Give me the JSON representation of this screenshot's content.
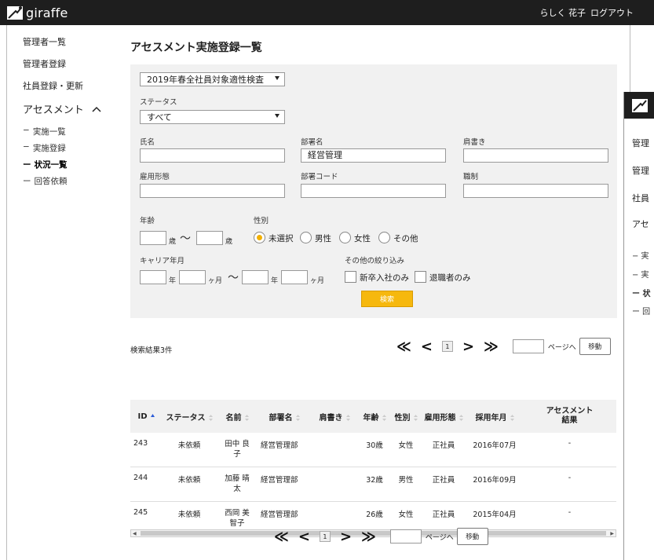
{
  "app": {
    "name": "giraffe",
    "user_name": "らしく 花子",
    "logout_label": "ログアウト"
  },
  "sidebar": {
    "items": [
      "管理者一覧",
      "管理者登録",
      "社員登録・更新"
    ],
    "accordion_label": "アセスメント",
    "sub_items": [
      "実施一覧",
      "実施登録",
      "状況一覧",
      "回答依頼"
    ],
    "bullet": "−",
    "active_bullet": "ー"
  },
  "page": {
    "title": "アセスメント実施登録一覧"
  },
  "search": {
    "assessment_select": "2019年春全社員対象適性検査",
    "status_label": "ステータス",
    "status_select": "すべて",
    "name_label": "氏名",
    "dept_label": "部署名",
    "dept_value": "経営管理",
    "title_label": "肩書き",
    "employment_label": "雇用形態",
    "dept_code_label": "部署コード",
    "position_label": "職制",
    "age_label": "年齢",
    "age_unit": "歳",
    "tilde": "〜",
    "gender_label": "性別",
    "gender_options": [
      "未選択",
      "男性",
      "女性",
      "その他"
    ],
    "career_label": "キャリア年月",
    "year_unit": "年",
    "month_unit": "ヶ月",
    "other_label": "その他の絞り込み",
    "checkbox_new_grad": "新卒入社のみ",
    "checkbox_retired": "退職者のみ",
    "search_button": "検索"
  },
  "results": {
    "count_text": "検索結果3件"
  },
  "pager": {
    "first": "≪",
    "prev": "<",
    "page": "1",
    "next": ">",
    "last": "≫",
    "page_label": "ページへ",
    "go_button": "移動"
  },
  "table": {
    "headers": [
      "ID",
      "ステータス",
      "名前",
      "部署名",
      "肩書き",
      "年齢",
      "性別",
      "雇用形態",
      "採用年月",
      "アセスメント結果"
    ],
    "rows": [
      {
        "id": "243",
        "status": "未依頼",
        "name": "田中 良子",
        "dept": "経営管理部",
        "title": "",
        "age": "30歳",
        "gender": "女性",
        "employment": "正社員",
        "hired": "2016年07月",
        "result": "-"
      },
      {
        "id": "244",
        "status": "未依頼",
        "name": "加藤 晴太",
        "dept": "経営管理部",
        "title": "",
        "age": "32歳",
        "gender": "男性",
        "employment": "正社員",
        "hired": "2016年09月",
        "result": "-"
      },
      {
        "id": "245",
        "status": "未依頼",
        "name": "西岡 美智子",
        "dept": "経営管理部",
        "title": "",
        "age": "26歳",
        "gender": "女性",
        "employment": "正社員",
        "hired": "2015年04月",
        "result": "-"
      }
    ]
  },
  "overlay": {
    "texts": [
      "管理",
      "管理",
      "社員",
      "アセ"
    ],
    "dashes": [
      "− 実",
      "− 実",
      "ー 状",
      "ー 回"
    ]
  },
  "colors": {
    "accent": "#f6b80e",
    "topbar": "#1e1e1e",
    "panel": "#f1f1f1"
  }
}
